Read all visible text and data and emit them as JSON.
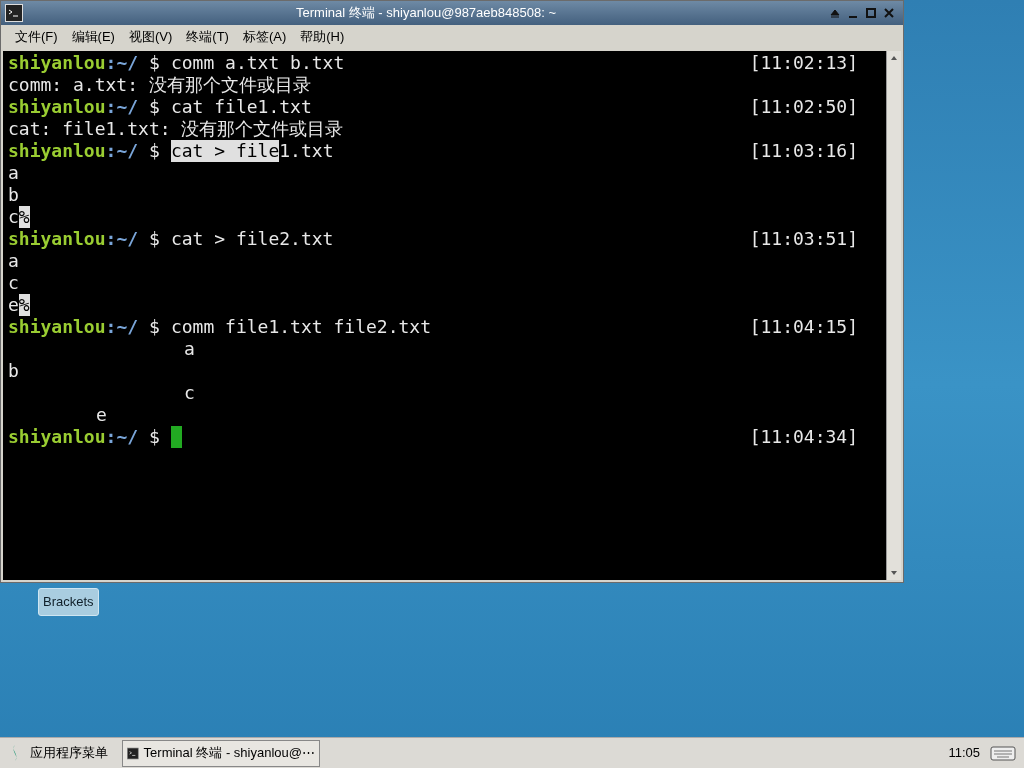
{
  "window": {
    "title": "Terminal 终端 - shiyanlou@987aeb848508: ~"
  },
  "menu": [
    "文件(F)",
    "编辑(E)",
    "视图(V)",
    "终端(T)",
    "标签(A)",
    "帮助(H)"
  ],
  "terminal": {
    "lines": [
      {
        "kind": "prompt",
        "user": "shiyanlou",
        "path": ":~/",
        "sign": "$",
        "segments": [
          {
            "text": "comm a.txt b.txt",
            "selected": false
          }
        ],
        "time": "[11:02:13]"
      },
      {
        "kind": "col1",
        "segments": [
          {
            "text": "comm: a.txt: 没有那个文件或目录",
            "selected": false
          }
        ]
      },
      {
        "kind": "prompt",
        "user": "shiyanlou",
        "path": ":~/",
        "sign": "$",
        "segments": [
          {
            "text": "cat file1.txt",
            "selected": false
          }
        ],
        "time": "[11:02:50]"
      },
      {
        "kind": "col1",
        "segments": [
          {
            "text": "cat: file1.txt: 没有那个文件或目录",
            "selected": false
          }
        ]
      },
      {
        "kind": "prompt",
        "user": "shiyanlou",
        "path": ":~/",
        "sign": "$",
        "segments": [
          {
            "text": "cat > file",
            "selected": true
          },
          {
            "text": "1.txt",
            "selected": false
          }
        ],
        "time": "[11:03:16]"
      },
      {
        "kind": "col1",
        "segments": [
          {
            "text": "a",
            "selected": false
          }
        ]
      },
      {
        "kind": "col1",
        "segments": [
          {
            "text": "b",
            "selected": false
          }
        ]
      },
      {
        "kind": "col1",
        "segments": [
          {
            "text": "c",
            "selected": false
          },
          {
            "text": "%",
            "selected": true
          }
        ]
      },
      {
        "kind": "prompt",
        "user": "shiyanlou",
        "path": ":~/",
        "sign": "$",
        "segments": [
          {
            "text": "cat > file2.txt",
            "selected": false
          }
        ],
        "time": "[11:03:51]"
      },
      {
        "kind": "col1",
        "segments": [
          {
            "text": "a",
            "selected": false
          }
        ]
      },
      {
        "kind": "col1",
        "segments": [
          {
            "text": "c",
            "selected": false
          }
        ]
      },
      {
        "kind": "col1",
        "segments": [
          {
            "text": "e",
            "selected": false
          },
          {
            "text": "%",
            "selected": true
          }
        ]
      },
      {
        "kind": "prompt",
        "user": "shiyanlou",
        "path": ":~/",
        "sign": "$",
        "segments": [
          {
            "text": "comm file1.txt file2.txt",
            "selected": false
          }
        ],
        "time": "[11:04:15]"
      },
      {
        "kind": "col3",
        "segments": [
          {
            "text": "a",
            "selected": false
          }
        ]
      },
      {
        "kind": "col1",
        "segments": [
          {
            "text": "b",
            "selected": false
          }
        ]
      },
      {
        "kind": "col3",
        "segments": [
          {
            "text": "c",
            "selected": false
          }
        ]
      },
      {
        "kind": "col2",
        "segments": [
          {
            "text": "e",
            "selected": false
          }
        ]
      },
      {
        "kind": "prompt",
        "user": "shiyanlou",
        "path": ":~/",
        "sign": "$",
        "cursor": true,
        "time": "[11:04:34]"
      }
    ]
  },
  "desktop": {
    "icons": [
      "Brackets"
    ]
  },
  "taskbar": {
    "start": "应用程序菜单",
    "tasks": [
      "Terminal 终端 - shiyanlou@⋯"
    ],
    "clock": "11:05"
  }
}
